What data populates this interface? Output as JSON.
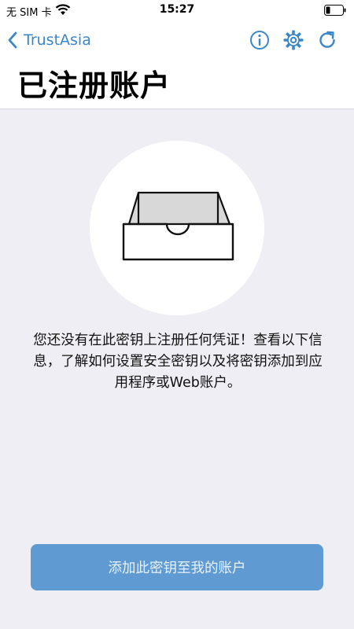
{
  "status_bar": {
    "carrier": "无 SIM 卡",
    "time": "15:27"
  },
  "header": {
    "back_label": "TrustAsia",
    "title": "已注册账户"
  },
  "nav_icons": [
    "info-icon",
    "gear-icon",
    "refresh-icon"
  ],
  "empty_state": {
    "illustration": "empty-tray-icon",
    "message": "您还没有在此密钥上注册任何凭证！查看以下信息，了解如何设置安全密钥以及将密钥添加到应用程序或Web账户。"
  },
  "primary_button": {
    "label": "添加此密钥至我的账户"
  },
  "colors": {
    "accent": "#3a86c8",
    "button_bg": "#5f9bd2",
    "background": "#efeef4"
  }
}
